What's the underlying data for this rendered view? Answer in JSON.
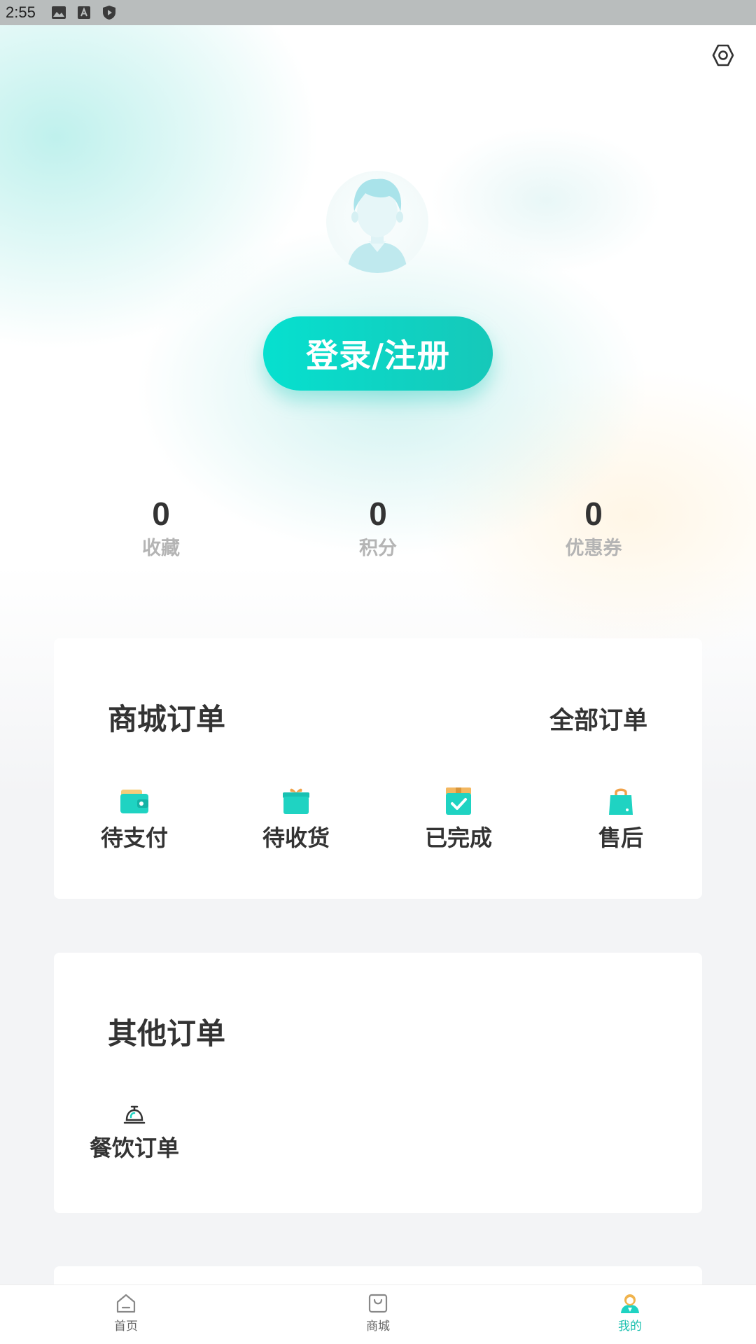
{
  "status_bar": {
    "time": "2:55"
  },
  "login_label": "登录/注册",
  "stats": [
    {
      "value": "0",
      "label": "收藏"
    },
    {
      "value": "0",
      "label": "积分"
    },
    {
      "value": "0",
      "label": "优惠券"
    }
  ],
  "mall_orders": {
    "title": "商城订单",
    "all_link": "全部订单",
    "items": [
      {
        "label": "待支付",
        "icon": "wallet-icon"
      },
      {
        "label": "待收货",
        "icon": "gift-box-icon"
      },
      {
        "label": "已完成",
        "icon": "check-box-icon"
      },
      {
        "label": "售后",
        "icon": "shopping-bag-icon"
      }
    ]
  },
  "other_orders": {
    "title": "其他订单",
    "items": [
      {
        "label": "餐饮订单",
        "icon": "service-bell-icon"
      }
    ]
  },
  "tabbar": [
    {
      "label": "首页",
      "icon": "home-icon",
      "active": false
    },
    {
      "label": "商城",
      "icon": "shopping-bag-icon",
      "active": false
    },
    {
      "label": "我的",
      "icon": "profile-icon",
      "active": true
    }
  ],
  "colors": {
    "accent": "#16c8b9",
    "accent_light": "#06e0cf",
    "text": "#333333",
    "muted": "#b4b4b4"
  }
}
